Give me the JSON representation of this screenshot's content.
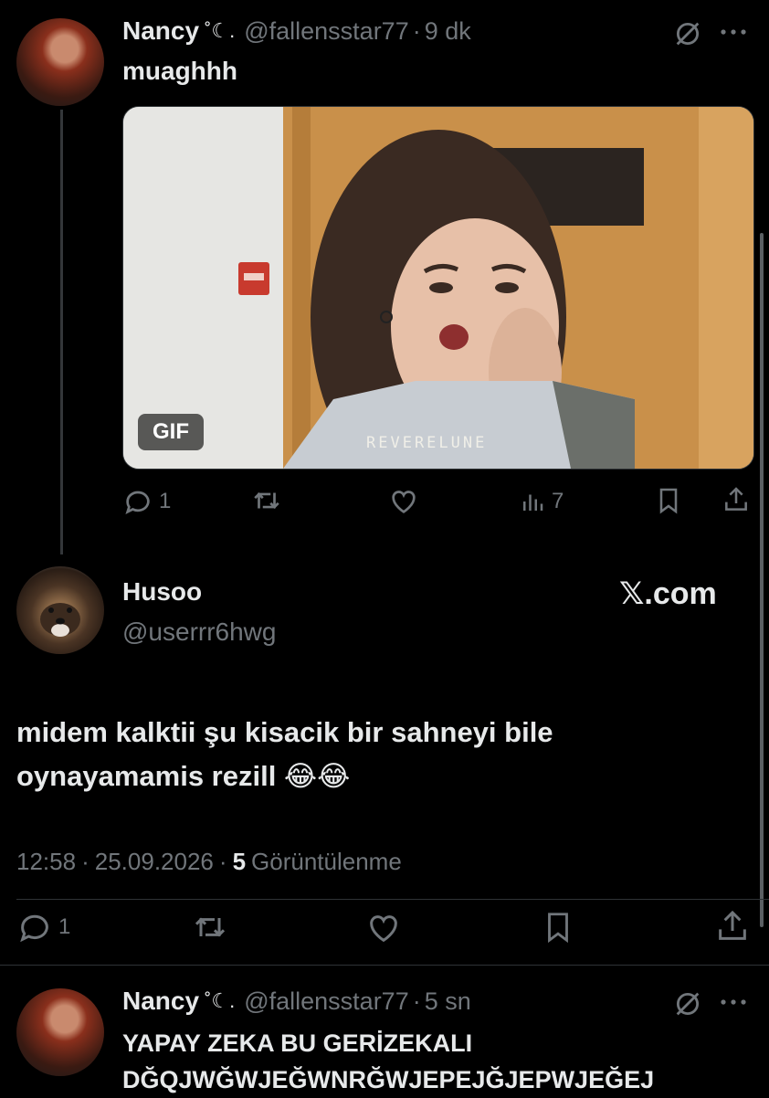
{
  "tweet1": {
    "display_name": "Nancy",
    "name_decoration": "˚☾.",
    "handle": "@fallensstar77",
    "time": "9 dk",
    "text": "muaghhh",
    "gif_badge": "GIF",
    "gif_watermark": "REVERELUNE",
    "actions": {
      "reply_count": "1",
      "views_count": "7"
    }
  },
  "tweet2": {
    "display_name": "Husoo",
    "handle": "@userrr6hwg",
    "brand": "𝕏.com",
    "text_line1": "midem kalktii şu kisacik bir sahneyi bile",
    "text_line2": "oynayamamis rezill 😂😂",
    "time": "12:58",
    "date": "25.09.2026",
    "views_count": "5",
    "views_label": "Görüntülenme",
    "actions": {
      "reply_count": "1"
    }
  },
  "tweet3": {
    "display_name": "Nancy",
    "name_decoration": "˚☾.",
    "handle": "@fallensstar77",
    "time": "5 sn",
    "text_line1": "YAPAY ZEKA BU GERİZEKALI",
    "text_line2": "DĞQJWĞWJEĞWNRĞWJEPEJĞJEPWJEĞEJ"
  },
  "colors": {
    "background": "#000000",
    "text": "#e7e9ea",
    "muted": "#71767b",
    "divider": "#2f3336"
  },
  "icons": [
    "reply-icon",
    "retweet-icon",
    "like-icon",
    "views-icon",
    "bookmark-icon",
    "share-icon",
    "mute-icon",
    "more-icon"
  ]
}
